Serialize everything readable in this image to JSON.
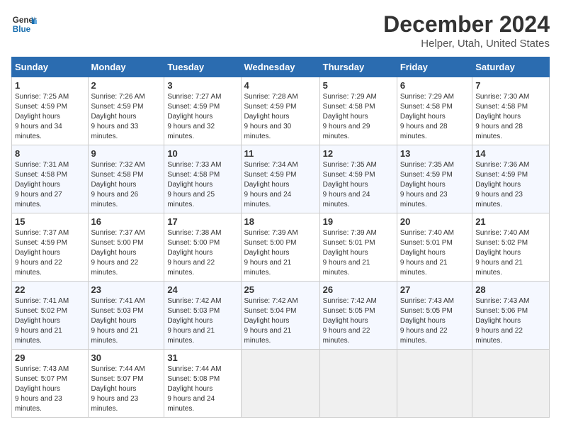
{
  "header": {
    "logo_line1": "General",
    "logo_line2": "Blue",
    "main_title": "December 2024",
    "subtitle": "Helper, Utah, United States"
  },
  "calendar": {
    "days_of_week": [
      "Sunday",
      "Monday",
      "Tuesday",
      "Wednesday",
      "Thursday",
      "Friday",
      "Saturday"
    ],
    "weeks": [
      [
        {
          "day": "1",
          "sunrise": "7:25 AM",
          "sunset": "4:59 PM",
          "daylight": "9 hours and 34 minutes."
        },
        {
          "day": "2",
          "sunrise": "7:26 AM",
          "sunset": "4:59 PM",
          "daylight": "9 hours and 33 minutes."
        },
        {
          "day": "3",
          "sunrise": "7:27 AM",
          "sunset": "4:59 PM",
          "daylight": "9 hours and 32 minutes."
        },
        {
          "day": "4",
          "sunrise": "7:28 AM",
          "sunset": "4:59 PM",
          "daylight": "9 hours and 30 minutes."
        },
        {
          "day": "5",
          "sunrise": "7:29 AM",
          "sunset": "4:58 PM",
          "daylight": "9 hours and 29 minutes."
        },
        {
          "day": "6",
          "sunrise": "7:29 AM",
          "sunset": "4:58 PM",
          "daylight": "9 hours and 28 minutes."
        },
        {
          "day": "7",
          "sunrise": "7:30 AM",
          "sunset": "4:58 PM",
          "daylight": "9 hours and 28 minutes."
        }
      ],
      [
        {
          "day": "8",
          "sunrise": "7:31 AM",
          "sunset": "4:58 PM",
          "daylight": "9 hours and 27 minutes."
        },
        {
          "day": "9",
          "sunrise": "7:32 AM",
          "sunset": "4:58 PM",
          "daylight": "9 hours and 26 minutes."
        },
        {
          "day": "10",
          "sunrise": "7:33 AM",
          "sunset": "4:58 PM",
          "daylight": "9 hours and 25 minutes."
        },
        {
          "day": "11",
          "sunrise": "7:34 AM",
          "sunset": "4:59 PM",
          "daylight": "9 hours and 24 minutes."
        },
        {
          "day": "12",
          "sunrise": "7:35 AM",
          "sunset": "4:59 PM",
          "daylight": "9 hours and 24 minutes."
        },
        {
          "day": "13",
          "sunrise": "7:35 AM",
          "sunset": "4:59 PM",
          "daylight": "9 hours and 23 minutes."
        },
        {
          "day": "14",
          "sunrise": "7:36 AM",
          "sunset": "4:59 PM",
          "daylight": "9 hours and 23 minutes."
        }
      ],
      [
        {
          "day": "15",
          "sunrise": "7:37 AM",
          "sunset": "4:59 PM",
          "daylight": "9 hours and 22 minutes."
        },
        {
          "day": "16",
          "sunrise": "7:37 AM",
          "sunset": "5:00 PM",
          "daylight": "9 hours and 22 minutes."
        },
        {
          "day": "17",
          "sunrise": "7:38 AM",
          "sunset": "5:00 PM",
          "daylight": "9 hours and 22 minutes."
        },
        {
          "day": "18",
          "sunrise": "7:39 AM",
          "sunset": "5:00 PM",
          "daylight": "9 hours and 21 minutes."
        },
        {
          "day": "19",
          "sunrise": "7:39 AM",
          "sunset": "5:01 PM",
          "daylight": "9 hours and 21 minutes."
        },
        {
          "day": "20",
          "sunrise": "7:40 AM",
          "sunset": "5:01 PM",
          "daylight": "9 hours and 21 minutes."
        },
        {
          "day": "21",
          "sunrise": "7:40 AM",
          "sunset": "5:02 PM",
          "daylight": "9 hours and 21 minutes."
        }
      ],
      [
        {
          "day": "22",
          "sunrise": "7:41 AM",
          "sunset": "5:02 PM",
          "daylight": "9 hours and 21 minutes."
        },
        {
          "day": "23",
          "sunrise": "7:41 AM",
          "sunset": "5:03 PM",
          "daylight": "9 hours and 21 minutes."
        },
        {
          "day": "24",
          "sunrise": "7:42 AM",
          "sunset": "5:03 PM",
          "daylight": "9 hours and 21 minutes."
        },
        {
          "day": "25",
          "sunrise": "7:42 AM",
          "sunset": "5:04 PM",
          "daylight": "9 hours and 21 minutes."
        },
        {
          "day": "26",
          "sunrise": "7:42 AM",
          "sunset": "5:05 PM",
          "daylight": "9 hours and 22 minutes."
        },
        {
          "day": "27",
          "sunrise": "7:43 AM",
          "sunset": "5:05 PM",
          "daylight": "9 hours and 22 minutes."
        },
        {
          "day": "28",
          "sunrise": "7:43 AM",
          "sunset": "5:06 PM",
          "daylight": "9 hours and 22 minutes."
        }
      ],
      [
        {
          "day": "29",
          "sunrise": "7:43 AM",
          "sunset": "5:07 PM",
          "daylight": "9 hours and 23 minutes."
        },
        {
          "day": "30",
          "sunrise": "7:44 AM",
          "sunset": "5:07 PM",
          "daylight": "9 hours and 23 minutes."
        },
        {
          "day": "31",
          "sunrise": "7:44 AM",
          "sunset": "5:08 PM",
          "daylight": "9 hours and 24 minutes."
        },
        null,
        null,
        null,
        null
      ]
    ]
  }
}
